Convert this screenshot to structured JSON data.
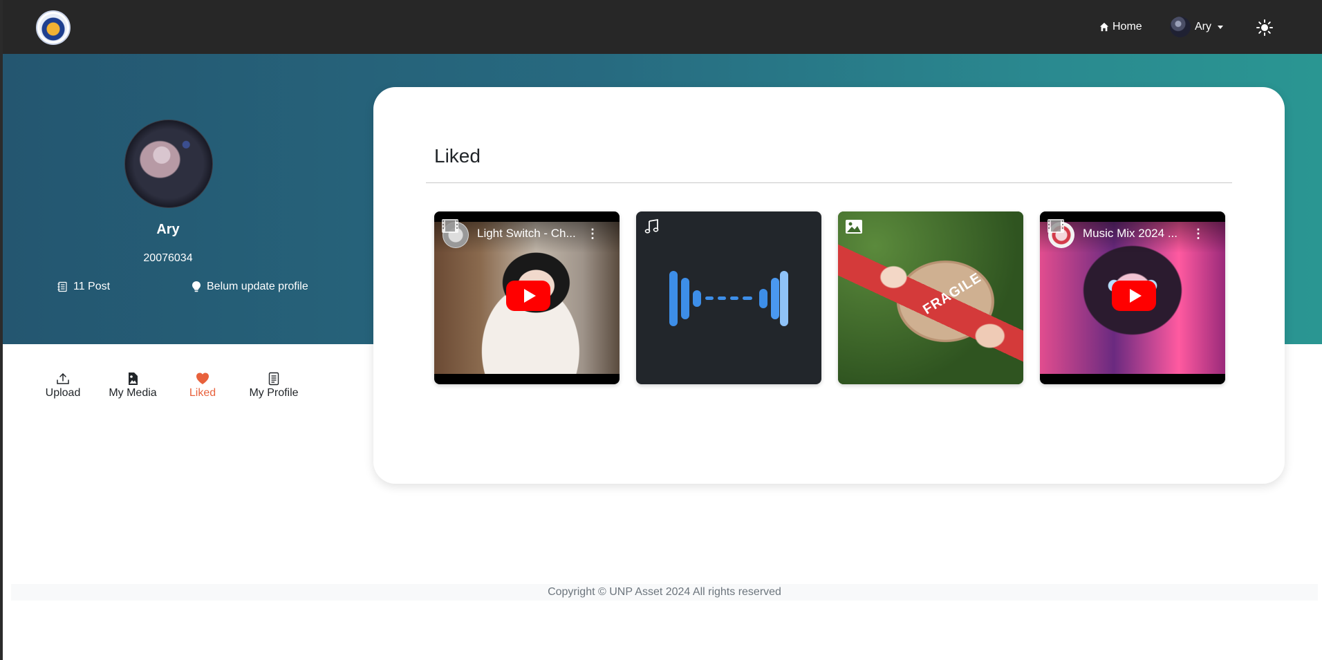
{
  "nav": {
    "home_label": "Home",
    "user_name": "Ary",
    "theme_icon": "sun-icon"
  },
  "profile": {
    "name": "Ary",
    "id": "20076034",
    "posts": "11 Post",
    "status": "Belum update profile"
  },
  "tabs": [
    {
      "label": "Upload",
      "icon": "upload-icon"
    },
    {
      "label": "My Media",
      "icon": "image-file-icon"
    },
    {
      "label": "Liked",
      "icon": "heart-icon",
      "active": true
    },
    {
      "label": "My Profile",
      "icon": "document-icon"
    }
  ],
  "liked": {
    "title": "Liked",
    "items": [
      {
        "type": "video",
        "icon": "film-icon",
        "title": "Light Switch - Ch..."
      },
      {
        "type": "audio",
        "icon": "music-note-icon"
      },
      {
        "type": "image",
        "icon": "image-icon",
        "text": "FRAGILE"
      },
      {
        "type": "video",
        "icon": "film-icon",
        "title": "Music Mix 2024 ..."
      }
    ]
  },
  "footer": {
    "copyright": "Copyright © UNP Asset 2024 All rights reserved"
  },
  "colors": {
    "navbar": "#272727",
    "hero_start": "#245670",
    "hero_end": "#2a9692",
    "active_tab": "#e8613c",
    "youtube_red": "#ff0000",
    "wave_blue": "#3d8ee8"
  }
}
